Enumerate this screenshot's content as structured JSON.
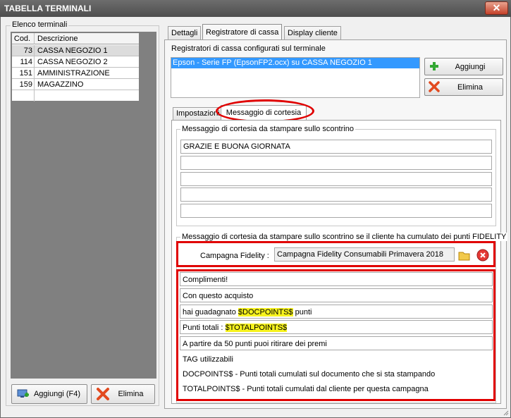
{
  "window": {
    "title": "TABELLA TERMINALI",
    "close_glyph": "✕"
  },
  "left": {
    "group_label": "Elenco terminali",
    "columns": [
      "Cod.",
      "Descrizione"
    ],
    "rows": [
      {
        "code": "73",
        "desc": "CASSA NEGOZIO 1",
        "selected": true
      },
      {
        "code": "114",
        "desc": "CASSA NEGOZIO 2",
        "selected": false
      },
      {
        "code": "151",
        "desc": "AMMINISTRAZIONE",
        "selected": false
      },
      {
        "code": "159",
        "desc": "MAGAZZINO",
        "selected": false
      }
    ],
    "add_button": "Aggiungi (F4)",
    "delete_button": "Elimina"
  },
  "right": {
    "tabs": [
      "Dettagli",
      "Registratore di cassa",
      "Display cliente"
    ],
    "active_tab": "Registratore di cassa",
    "registers_label": "Registratori di cassa configurati sul terminale",
    "registers": [
      "Epson - Serie FP (EpsonFP2.ocx) su CASSA NEGOZIO 1"
    ],
    "add_button": "Aggiungi",
    "delete_button": "Elimina",
    "subtabs": [
      "Impostazioni",
      "Messaggio di cortesia"
    ],
    "active_subtab": "Messaggio di cortesia",
    "courtesy": {
      "label": "Messaggio di cortesia da stampare sullo scontrino",
      "lines": [
        "GRAZIE E BUONA GIORNATA",
        "",
        "",
        "",
        ""
      ]
    },
    "fidelity": {
      "label": "Messaggio di cortesia da stampare sullo scontrino se il cliente ha cumulato dei punti FIDELITY",
      "campaign_label": "Campagna Fidelity :",
      "campaign_value": "Campagna Fidelity Consumabili Primavera 2018",
      "lines": [
        {
          "pre": "Complimenti!",
          "tag": "",
          "post": ""
        },
        {
          "pre": "Con questo acquisto",
          "tag": "",
          "post": ""
        },
        {
          "pre": "hai guadagnato ",
          "tag": "$DOCPOINTS$",
          "post": " punti"
        },
        {
          "pre": "Punti totali : ",
          "tag": "$TOTALPOINTS$",
          "post": ""
        },
        {
          "pre": "A partire da 50 punti puoi ritirare dei premi",
          "tag": "",
          "post": ""
        }
      ],
      "tags_title": "TAG utilizzabili",
      "tags": [
        "DOCPOINTS$ - Punti totali cumulati sul documento che si sta stampando",
        "TOTALPOINTS$ - Punti totali cumulati dal cliente per questa campagna"
      ]
    }
  },
  "colors": {
    "highlight": "#f7f31e",
    "annotation": "#e00000",
    "selection": "#3399ff"
  }
}
